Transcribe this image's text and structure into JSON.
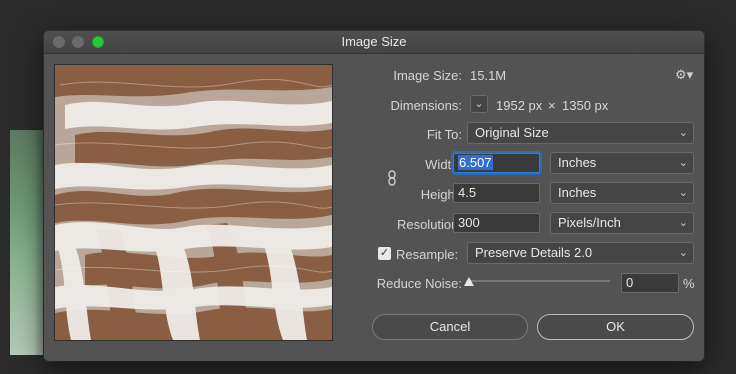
{
  "window": {
    "title": "Image Size"
  },
  "info": {
    "image_size_label": "Image Size:",
    "image_size_value": "15.1M",
    "dimensions_label": "Dimensions:",
    "dim_w": "1952 px",
    "dim_x": "×",
    "dim_h": "1350 px"
  },
  "fit_to": {
    "label": "Fit To:",
    "value": "Original Size"
  },
  "width": {
    "label": "Width:",
    "value": "6.507",
    "unit": "Inches"
  },
  "height": {
    "label": "Height:",
    "value": "4.5",
    "unit": "Inches"
  },
  "resolution": {
    "label": "Resolution:",
    "value": "300",
    "unit": "Pixels/Inch"
  },
  "resample": {
    "label": "Resample:",
    "checked": true,
    "value": "Preserve Details 2.0"
  },
  "reduce_noise": {
    "label": "Reduce Noise:",
    "value": "0",
    "unit": "%",
    "level": 0
  },
  "buttons": {
    "cancel": "Cancel",
    "ok": "OK"
  },
  "colors": {
    "accent": "#2f7fd6",
    "zoom": "#27c93f",
    "dialog_bg": "#535353"
  }
}
